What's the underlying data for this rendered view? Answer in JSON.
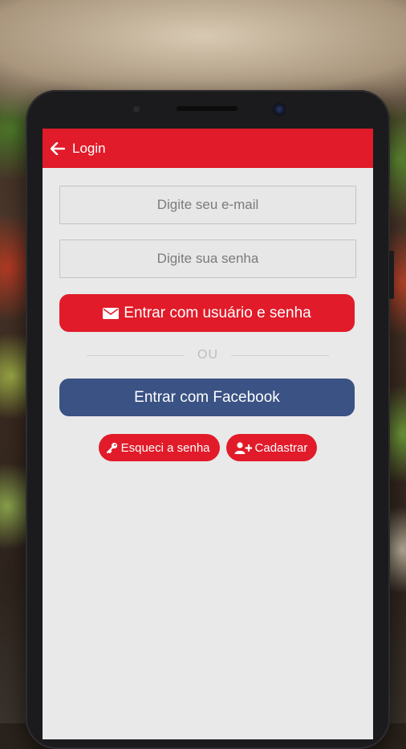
{
  "appbar": {
    "back_icon": "arrow-left-icon",
    "title": "Login"
  },
  "form": {
    "email_placeholder": "Digite seu e-mail",
    "email_value": "",
    "password_placeholder": "Digite sua senha",
    "password_value": ""
  },
  "buttons": {
    "login_icon": "envelope-icon",
    "login_label": "Entrar com usuário e senha",
    "divider_text": "OU",
    "facebook_label": "Entrar com Facebook",
    "forgot_icon": "key-icon",
    "forgot_label": "Esqueci a senha",
    "register_icon": "user-plus-icon",
    "register_label": "Cadastrar"
  },
  "colors": {
    "primary_red": "#e11b29",
    "facebook_blue": "#3a5284",
    "screen_bg": "#e9e9e9"
  }
}
